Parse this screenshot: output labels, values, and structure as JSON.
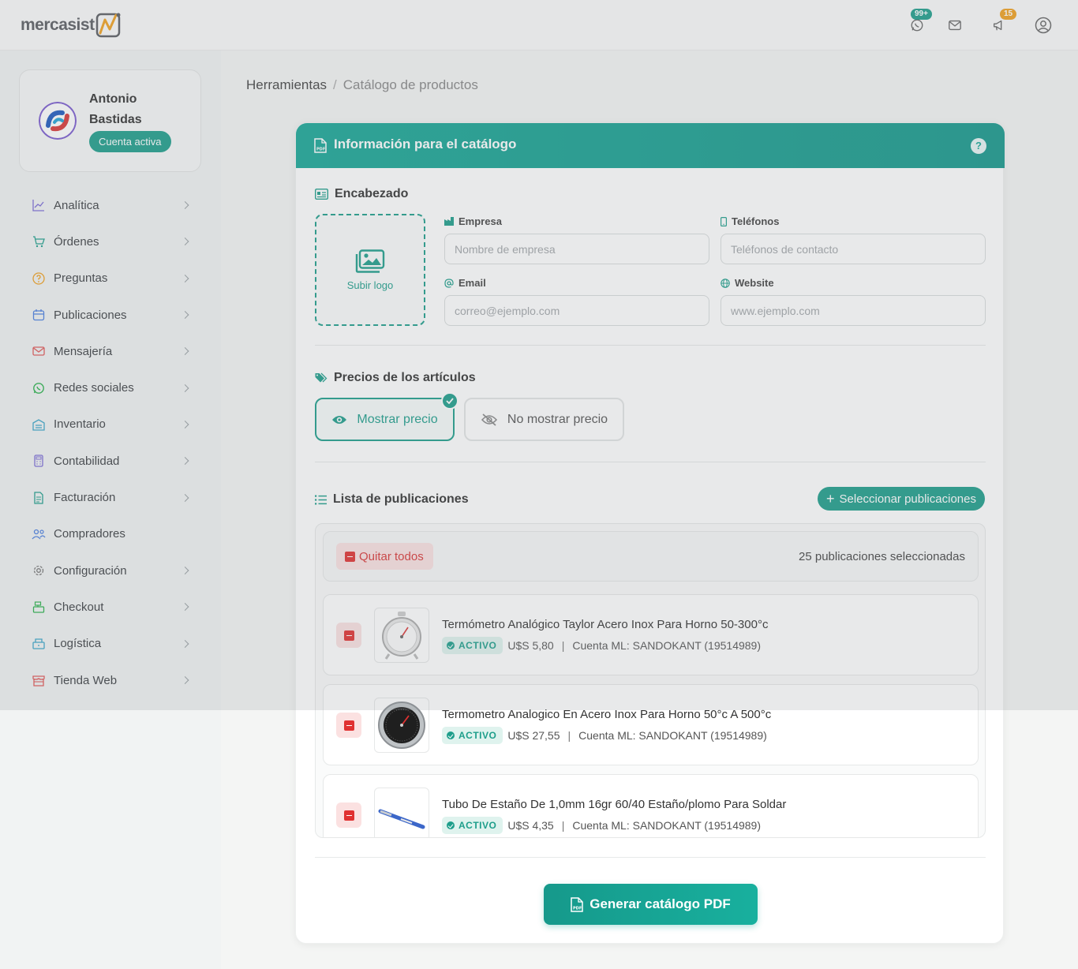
{
  "brand": {
    "logo_text": "mercasist"
  },
  "topbar": {
    "whatsapp_badge": "99+",
    "notifications_badge": "15",
    "colors": {
      "whatsapp_badge": "#1e9e8b",
      "notifications_badge": "#f0a020"
    }
  },
  "user": {
    "name": "Antonio Bastidas",
    "status": "Cuenta activa"
  },
  "sidebar": {
    "items": [
      {
        "label": "Analítica",
        "icon": "chart-line-icon"
      },
      {
        "label": "Órdenes",
        "icon": "cart-icon"
      },
      {
        "label": "Preguntas",
        "icon": "question-icon"
      },
      {
        "label": "Publicaciones",
        "icon": "calendar-icon"
      },
      {
        "label": "Mensajería",
        "icon": "mail-icon"
      },
      {
        "label": "Redes sociales",
        "icon": "whatsapp-icon"
      },
      {
        "label": "Inventario",
        "icon": "warehouse-icon"
      },
      {
        "label": "Contabilidad",
        "icon": "calculator-icon"
      },
      {
        "label": "Facturación",
        "icon": "invoice-icon"
      },
      {
        "label": "Compradores",
        "icon": "users-icon"
      },
      {
        "label": "Configuración",
        "icon": "gear-icon"
      },
      {
        "label": "Checkout",
        "icon": "cash-register-icon"
      },
      {
        "label": "Logística",
        "icon": "truck-icon"
      },
      {
        "label": "Tienda Web",
        "icon": "store-icon"
      }
    ]
  },
  "breadcrumb": {
    "root": "Herramientas",
    "separator": "/",
    "current": "Catálogo de productos"
  },
  "card": {
    "title": "Información para el catálogo",
    "help": "?",
    "header_section": {
      "title": "Encabezado",
      "upload_label": "Subir logo",
      "fields": {
        "empresa": {
          "label": "Empresa",
          "placeholder": "Nombre de empresa",
          "value": ""
        },
        "telefonos": {
          "label": "Teléfonos",
          "placeholder": "Teléfonos de contacto",
          "value": ""
        },
        "email": {
          "label": "Email",
          "placeholder": "correo@ejemplo.com",
          "value": ""
        },
        "website": {
          "label": "Website",
          "placeholder": "www.ejemplo.com",
          "value": ""
        }
      }
    },
    "prices": {
      "title": "Precios de los artículos",
      "show_label": "Mostrar precio",
      "hide_label": "No mostrar precio",
      "selected": "show"
    },
    "list": {
      "title": "Lista de publicaciones",
      "select_button": "Seleccionar publicaciones",
      "remove_all": "Quitar todos",
      "count_text": "25 publicaciones seleccionadas",
      "items": [
        {
          "title": "Termómetro Analógico Taylor Acero Inox Para Horno 50-300°c",
          "status": "ACTIVO",
          "price": "U$S 5,80",
          "account": "Cuenta ML: SANDOKANT (19514989)"
        },
        {
          "title": "Termometro Analogico En Acero Inox Para Horno 50°c A 500°c",
          "status": "ACTIVO",
          "price": "U$S 27,55",
          "account": "Cuenta ML: SANDOKANT (19514989)"
        },
        {
          "title": "Tubo De Estaño De 1,0mm 16gr 60/40 Estaño/plomo Para Soldar",
          "status": "ACTIVO",
          "price": "U$S 4,35",
          "account": "Cuenta ML: SANDOKANT (19514989)"
        }
      ]
    },
    "generate_button": "Generar catálogo PDF"
  },
  "colors": {
    "accent": "#1e9e8b",
    "danger": "#e03131"
  }
}
